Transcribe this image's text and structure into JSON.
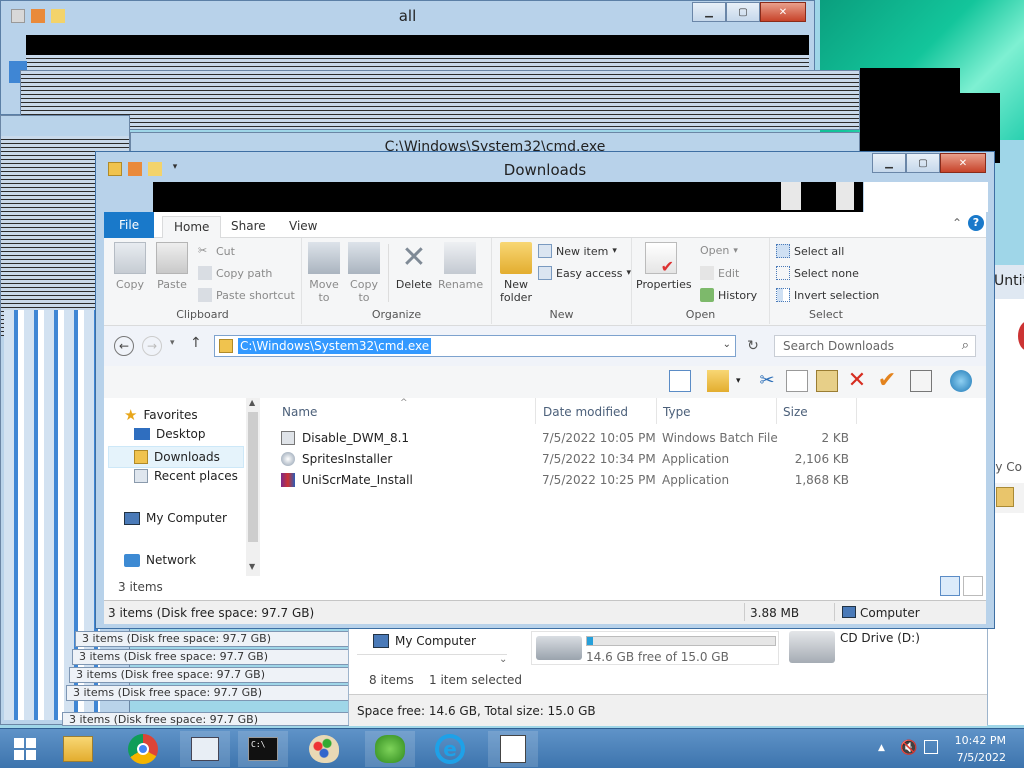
{
  "background_windows": {
    "top_window_title": "all",
    "cmd_window_title": "C:\\Windows\\System32\\cmd.exe",
    "ghost_status_text": "3 items (Disk free space: 97.7 GB)",
    "right_window_title": "Untit",
    "right_window_fragment": "ly Co"
  },
  "lower_window": {
    "nav_item": "My Computer",
    "items_count": "8 items",
    "selected_count": "1 item selected",
    "drive1_free": "14.6 GB free of 15.0 GB",
    "drive1_fill_fraction": 0.03,
    "drive2_label": "CD Drive (D:)",
    "status": "Space free: 14.6 GB, Total size: 15.0 GB"
  },
  "explorer": {
    "title": "Downloads",
    "tabs": [
      "File",
      "Home",
      "Share",
      "View"
    ],
    "ribbon": {
      "clipboard": {
        "label": "Clipboard",
        "copy": "Copy",
        "paste": "Paste",
        "cut": "Cut",
        "copy_path": "Copy path",
        "paste_shortcut": "Paste shortcut"
      },
      "organize": {
        "label": "Organize",
        "move_to": "Move to",
        "copy_to": "Copy to",
        "delete": "Delete",
        "rename": "Rename"
      },
      "new": {
        "label": "New",
        "new_folder": "New folder",
        "new_item": "New item",
        "easy_access": "Easy access"
      },
      "open": {
        "label": "Open",
        "properties": "Properties",
        "open": "Open",
        "edit": "Edit",
        "history": "History"
      },
      "select": {
        "label": "Select",
        "select_all": "Select all",
        "select_none": "Select none",
        "invert_selection": "Invert selection"
      }
    },
    "address": "C:\\Windows\\System32\\cmd.exe",
    "search_placeholder": "Search Downloads",
    "nav": {
      "favorites": "Favorites",
      "desktop": "Desktop",
      "downloads": "Downloads",
      "recent": "Recent places",
      "computer": "My Computer",
      "network": "Network",
      "items": "3 items"
    },
    "columns": {
      "name": "Name",
      "date": "Date modified",
      "type": "Type",
      "size": "Size"
    },
    "files": [
      {
        "name": "Disable_DWM_8.1",
        "date": "7/5/2022 10:05 PM",
        "type": "Windows Batch File",
        "size": "2 KB"
      },
      {
        "name": "SpritesInstaller",
        "date": "7/5/2022 10:34 PM",
        "type": "Application",
        "size": "2,106 KB"
      },
      {
        "name": "UniScrMate_Install",
        "date": "7/5/2022 10:25 PM",
        "type": "Application",
        "size": "1,868 KB"
      }
    ],
    "status": {
      "left": "3 items (Disk free space: 97.7 GB)",
      "size": "3.88 MB",
      "location": "Computer"
    }
  },
  "taskbar": {
    "time": "10:42 PM",
    "date": "7/5/2022"
  },
  "colors": {
    "accent": "#1979ca",
    "selection": "#3399ff",
    "close": "#c7432a"
  }
}
